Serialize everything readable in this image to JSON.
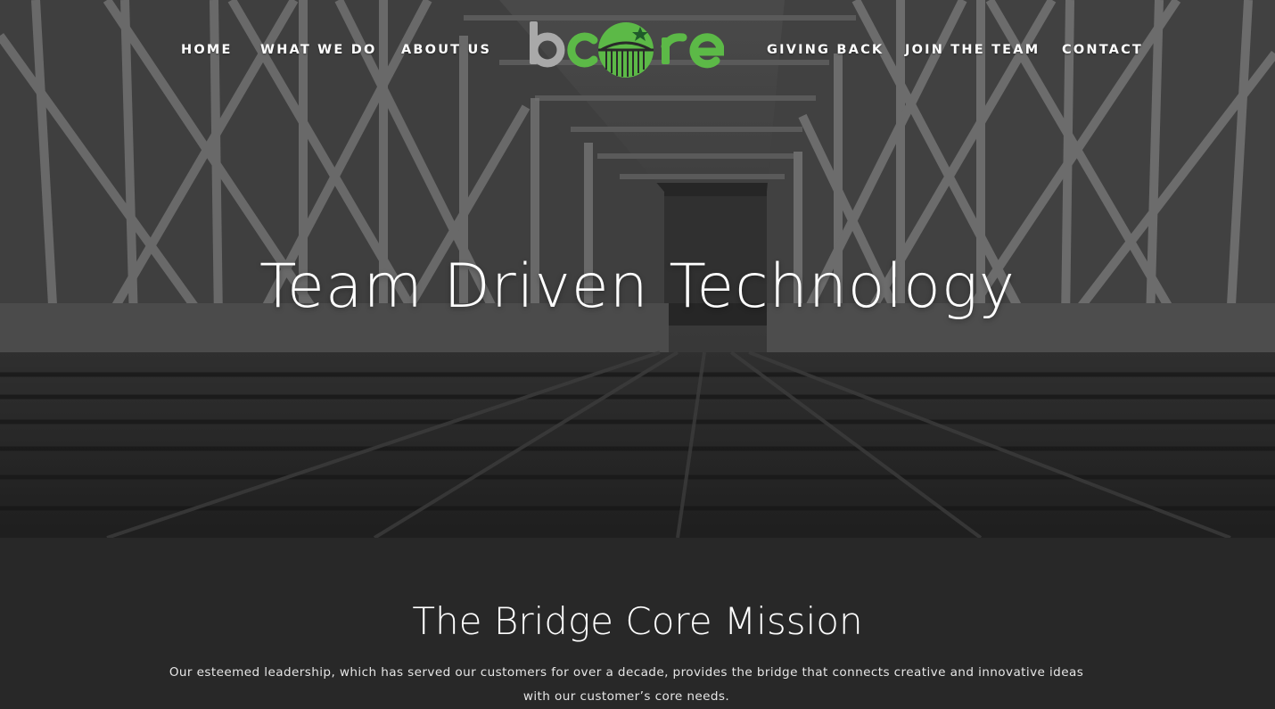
{
  "nav": {
    "left": [
      {
        "label": "HOME"
      },
      {
        "label": "WHAT WE DO"
      },
      {
        "label": "ABOUT US"
      }
    ],
    "right": [
      {
        "label": "GIVING BACK"
      },
      {
        "label": "JOIN THE TEAM"
      },
      {
        "label": "CONTACT"
      }
    ]
  },
  "logo": {
    "text": "bcore",
    "colors": {
      "b": "#a9a9a9",
      "core": "#5cb947",
      "star": "#1f5a2a"
    }
  },
  "hero": {
    "title": "Team Driven Technology",
    "background": "black-and-white-bridge-photo"
  },
  "mission": {
    "title": "The Bridge Core Mission",
    "body": "Our esteemed leadership, which has served our customers for over a decade, provides the bridge that connects creative and innovative ideas with our customer’s core needs."
  },
  "colors": {
    "page_bg": "#282828",
    "text": "#ffffff",
    "accent": "#5cb947"
  }
}
